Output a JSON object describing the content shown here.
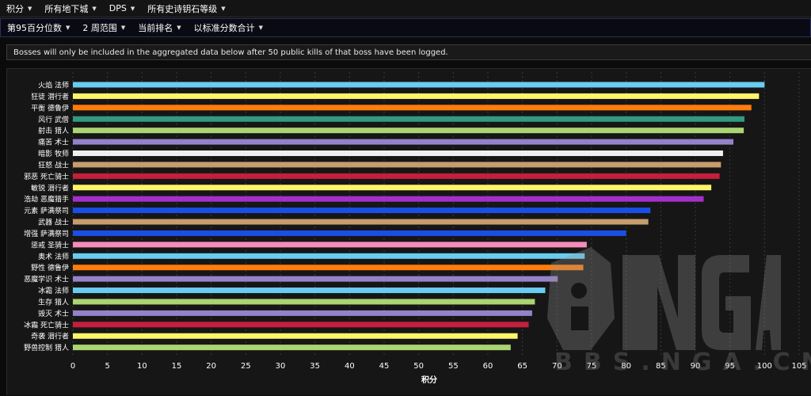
{
  "menu": [
    {
      "label": "积分"
    },
    {
      "label": "所有地下城"
    },
    {
      "label": "DPS"
    },
    {
      "label": "所有史诗钥石等级"
    }
  ],
  "submenu": [
    {
      "label": "第95百分位数"
    },
    {
      "label": "2 周范围"
    },
    {
      "label": "当前排名"
    },
    {
      "label": "以标准分数合计"
    }
  ],
  "notice": "Bosses will only be included in the aggregated data below after 50 public kills of that boss have been logged.",
  "watermark": {
    "text": "BBS.NGA.CN"
  },
  "chart_data": {
    "type": "bar",
    "orientation": "horizontal",
    "title": "",
    "xlabel": "积分",
    "ylabel": "",
    "xlim": [
      0,
      105
    ],
    "xticks": [
      0,
      5,
      10,
      15,
      20,
      25,
      30,
      35,
      40,
      45,
      50,
      55,
      60,
      65,
      70,
      75,
      80,
      85,
      90,
      95,
      100,
      105
    ],
    "grid": true,
    "categories": [
      "火焰 法师",
      "狂徒 潜行者",
      "平衡 德鲁伊",
      "风行 武僧",
      "射击 猎人",
      "痛苦 术士",
      "暗影 牧师",
      "狂怒 战士",
      "邪恶 死亡骑士",
      "敏锐 潜行者",
      "浩劫 恶魔猎手",
      "元素 萨满祭司",
      "武器 战士",
      "增强 萨满祭司",
      "惩戒 圣骑士",
      "奥术 法师",
      "野性 德鲁伊",
      "恶魔学识 术士",
      "冰霜 法师",
      "生存 猎人",
      "毁灭 术士",
      "冰霜 死亡骑士",
      "奇袭 潜行者",
      "野兽控制 猎人"
    ],
    "values": [
      100,
      99.2,
      98.1,
      97.1,
      97.0,
      95.5,
      94.0,
      93.7,
      93.5,
      92.3,
      91.2,
      83.5,
      83.2,
      80.0,
      74.3,
      74.0,
      73.8,
      70.1,
      68.3,
      66.8,
      66.4,
      65.9,
      64.3,
      63.3
    ],
    "colors": [
      "#69CCF0",
      "#FFF569",
      "#FF7D0A",
      "#339980",
      "#ABD473",
      "#9482C9",
      "#F0F0F0",
      "#C79C6E",
      "#C41F3B",
      "#FFF569",
      "#A330C9",
      "#1A4FE6",
      "#C79C6E",
      "#1A4FE6",
      "#F58CBA",
      "#69CCF0",
      "#FF7D0A",
      "#9482C9",
      "#69CCF0",
      "#ABD473",
      "#9482C9",
      "#C41F3B",
      "#FFF569",
      "#ABD473"
    ]
  }
}
